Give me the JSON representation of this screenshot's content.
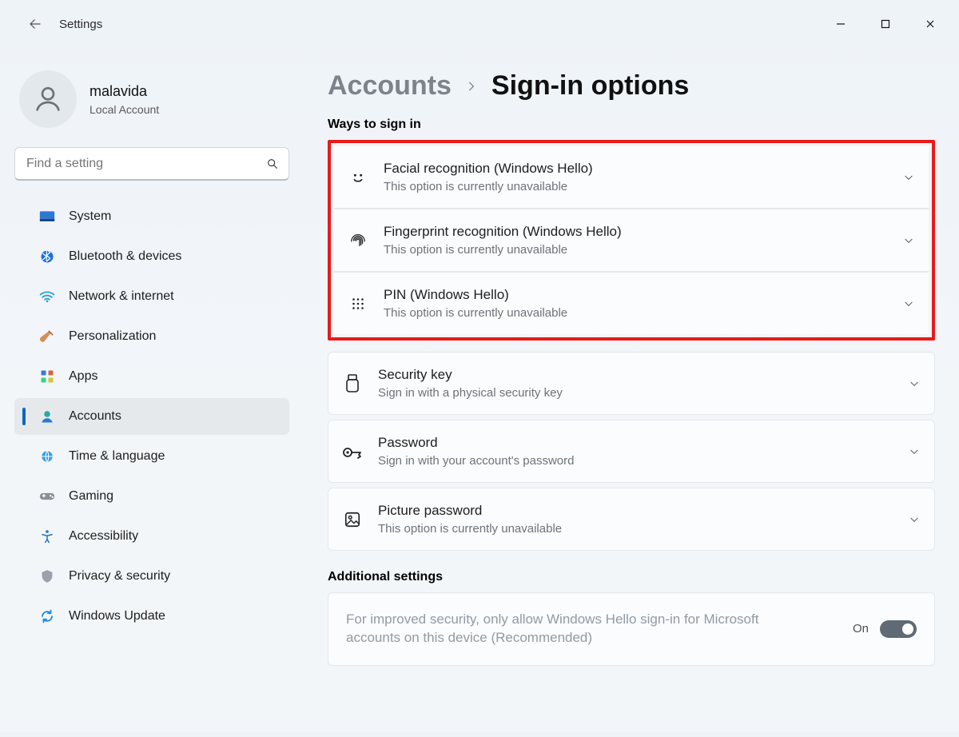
{
  "window": {
    "title": "Settings"
  },
  "profile": {
    "name": "malavida",
    "type": "Local Account"
  },
  "search": {
    "placeholder": "Find a setting"
  },
  "nav": {
    "items": [
      {
        "label": "System",
        "icon": "monitor",
        "active": false
      },
      {
        "label": "Bluetooth & devices",
        "icon": "bluetooth",
        "active": false
      },
      {
        "label": "Network & internet",
        "icon": "wifi",
        "active": false
      },
      {
        "label": "Personalization",
        "icon": "brush",
        "active": false
      },
      {
        "label": "Apps",
        "icon": "apps",
        "active": false
      },
      {
        "label": "Accounts",
        "icon": "user",
        "active": true
      },
      {
        "label": "Time & language",
        "icon": "globe",
        "active": false
      },
      {
        "label": "Gaming",
        "icon": "gamepad",
        "active": false
      },
      {
        "label": "Accessibility",
        "icon": "accessibility",
        "active": false
      },
      {
        "label": "Privacy & security",
        "icon": "shield",
        "active": false
      },
      {
        "label": "Windows Update",
        "icon": "update",
        "active": false
      }
    ]
  },
  "breadcrumb": {
    "parent": "Accounts",
    "current": "Sign-in options"
  },
  "sections": {
    "ways_title": "Ways to sign in",
    "ways": [
      {
        "title": "Facial recognition (Windows Hello)",
        "sub": "This option is currently unavailable",
        "icon": "face",
        "highlighted": true
      },
      {
        "title": "Fingerprint recognition (Windows Hello)",
        "sub": "This option is currently unavailable",
        "icon": "fingerprint",
        "highlighted": true
      },
      {
        "title": "PIN (Windows Hello)",
        "sub": "This option is currently unavailable",
        "icon": "pin",
        "highlighted": true
      },
      {
        "title": "Security key",
        "sub": "Sign in with a physical security key",
        "icon": "security-key",
        "highlighted": false
      },
      {
        "title": "Password",
        "sub": "Sign in with your account's password",
        "icon": "password",
        "highlighted": false
      },
      {
        "title": "Picture password",
        "sub": "This option is currently unavailable",
        "icon": "picture",
        "highlighted": false
      }
    ],
    "additional_title": "Additional settings",
    "additional": {
      "desc": "For improved security, only allow Windows Hello sign-in for Microsoft accounts on this device (Recommended)",
      "state": "On",
      "toggled": true
    }
  }
}
